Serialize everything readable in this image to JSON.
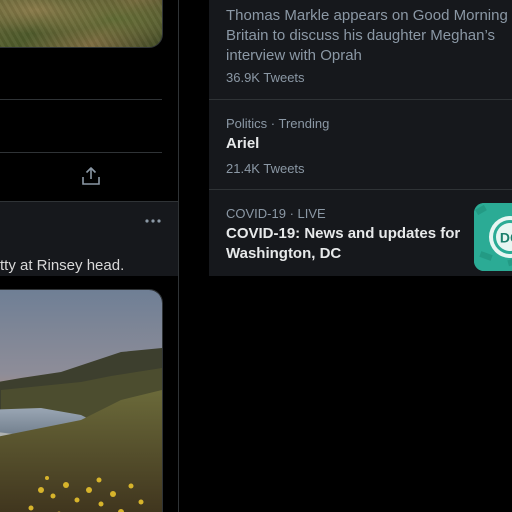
{
  "timeline": {
    "tweet_text": "tty at Rinsey head."
  },
  "trends": {
    "items": [
      {
        "description": "Thomas Markle appears on Good Morning Britain to discuss his daughter Meghan’s interview with Oprah",
        "count": "36.9K Tweets"
      },
      {
        "context": "Politics · Trending",
        "title": "Ariel",
        "count": "21.4K Tweets"
      },
      {
        "context": "COVID-19 · LIVE",
        "title": "COVID-19: News and updates for Washington, DC",
        "thumb_text": "DC"
      }
    ]
  },
  "colors": {
    "background": "#000000",
    "panel": "#16181c",
    "border": "#2f3336",
    "text_primary": "#e7e9ea",
    "text_secondary": "#8b98a5",
    "covid_thumb": "#2bab95"
  },
  "icons": {
    "share": "share-icon",
    "more": "more-options-icon"
  }
}
